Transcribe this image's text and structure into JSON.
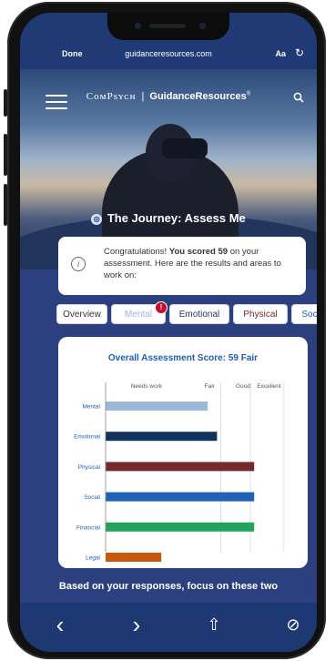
{
  "browser": {
    "done_label": "Done",
    "url": "guidanceresources.com",
    "text_size_label": "Aa",
    "reload_icon": "reload-icon"
  },
  "header": {
    "brand_name": "CᴏᴍPsʏᴄʜ",
    "separator": "|",
    "site_name": "GuidanceResources",
    "registered": "®",
    "menu_icon": "hamburger-menu-icon",
    "search_icon": "search-icon"
  },
  "hero": {
    "title": "The Journey: Assess Me"
  },
  "congrats": {
    "prefix": "Congratulations! ",
    "score_bold": "You scored 59",
    "suffix": " on your assessment. Here are the results and areas to work on:"
  },
  "tabs": [
    {
      "label": "Overview",
      "color": "#333333"
    },
    {
      "label": "Mental",
      "color": "#9fb6d6"
    },
    {
      "label": "Emotional",
      "color": "#1e3a6b"
    },
    {
      "label": "Physical",
      "color": "#7a2a2a"
    },
    {
      "label": "Social",
      "color": "#1f5cb8"
    }
  ],
  "tab_badge": "!",
  "chart_data": {
    "type": "bar",
    "orientation": "horizontal",
    "title": "Overall Assessment Score: 59 Fair",
    "scale_labels": [
      "Needs work",
      "Fair",
      "Good",
      "Excellent"
    ],
    "categories": [
      "Mental",
      "Emotional",
      "Physical",
      "Social",
      "Financial",
      "Legal"
    ],
    "values": [
      55,
      60,
      80,
      80,
      80,
      30
    ],
    "xlim": [
      0,
      100
    ],
    "colors": [
      "#9db8d6",
      "#13335f",
      "#742a2e",
      "#1f62b8",
      "#23a35b",
      "#c7590f"
    ],
    "grid": true
  },
  "footer": {
    "focus_text": "Based on your responses, focus on these two"
  },
  "toolbar": {
    "back": "‹",
    "forward": "›",
    "share": "⇧",
    "compass": "⊘"
  }
}
